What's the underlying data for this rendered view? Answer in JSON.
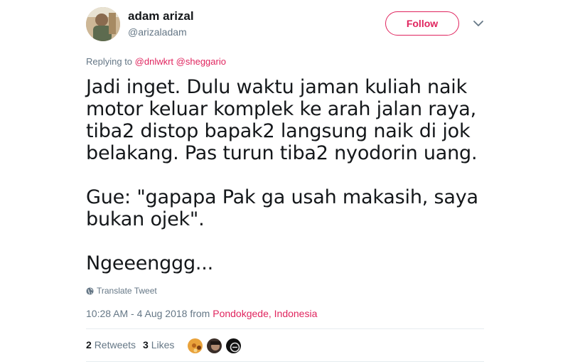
{
  "user": {
    "display_name": "adam arizal",
    "handle": "@arizaladam"
  },
  "follow_button": {
    "label": "Follow"
  },
  "reply": {
    "prefix": "Replying to ",
    "mentions": [
      "@dnlwkrt",
      "@sheggario"
    ]
  },
  "tweet": {
    "text": "Jadi inget. Dulu waktu jaman kuliah naik\nmotor keluar komplek ke arah jalan raya,\ntiba2 distop bapak2 langsung naik di jok\nbelakang. Pas turun tiba2 nyodorin uang.\n\nGue: \"gapapa Pak ga usah makasih, saya\nbukan ojek\".\n\nNgeeenggg..."
  },
  "translate": {
    "label": "Translate Tweet",
    "icon": "globe-icon"
  },
  "meta": {
    "time": "10:28 AM - 4 Aug 2018",
    "from_label": " from ",
    "location": "Pondokgede, Indonesia"
  },
  "stats": {
    "retweets_count": "2",
    "retweets_label": "Retweets",
    "likes_count": "3",
    "likes_label": "Likes"
  },
  "colors": {
    "accent": "#e0245e",
    "secondary_text": "#657786",
    "divider": "#e6ecf0"
  }
}
